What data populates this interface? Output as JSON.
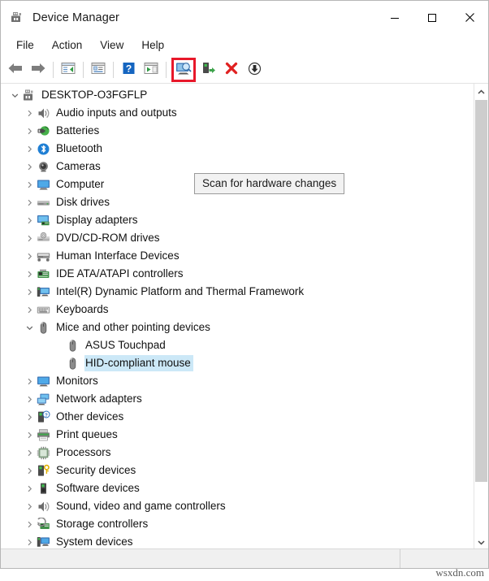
{
  "window": {
    "title": "Device Manager",
    "title_icon": "device-manager-icon",
    "controls": {
      "minimize": "minimize-icon",
      "maximize": "maximize-icon",
      "close": "close-icon"
    }
  },
  "menubar": {
    "items": [
      {
        "label": "File"
      },
      {
        "label": "Action"
      },
      {
        "label": "View"
      },
      {
        "label": "Help"
      }
    ]
  },
  "toolbar": {
    "highlight_color": "#e8182a",
    "buttons": [
      {
        "name": "back-button",
        "icon": "back-arrow-icon",
        "highlighted": false
      },
      {
        "name": "forward-button",
        "icon": "forward-arrow-icon",
        "highlighted": false
      },
      {
        "name": "show-hide-console-tree-button",
        "icon": "console-tree-icon",
        "highlighted": false
      },
      {
        "name": "properties-button",
        "icon": "properties-icon",
        "highlighted": false
      },
      {
        "name": "help-button",
        "icon": "help-question-icon",
        "highlighted": false
      },
      {
        "name": "show-hide-action-pane-button",
        "icon": "action-pane-icon",
        "highlighted": false
      },
      {
        "name": "scan-for-hardware-changes-button",
        "icon": "scan-hardware-icon",
        "highlighted": true
      },
      {
        "name": "update-driver-button",
        "icon": "update-driver-icon",
        "highlighted": false
      },
      {
        "name": "uninstall-device-button",
        "icon": "red-x-icon",
        "highlighted": false
      },
      {
        "name": "disable-device-button",
        "icon": "down-arrow-circle-icon",
        "highlighted": false
      }
    ]
  },
  "tooltip": {
    "text": "Scan for hardware changes"
  },
  "tree": {
    "items": [
      {
        "label": "DESKTOP-O3FGFLP",
        "level": 0,
        "twisty": "expanded",
        "icon": "computer-root-icon",
        "selected": false
      },
      {
        "label": "Audio inputs and outputs",
        "level": 1,
        "twisty": "collapsed",
        "icon": "speaker-icon",
        "selected": false
      },
      {
        "label": "Batteries",
        "level": 1,
        "twisty": "collapsed",
        "icon": "battery-icon",
        "selected": false
      },
      {
        "label": "Bluetooth",
        "level": 1,
        "twisty": "collapsed",
        "icon": "bluetooth-icon",
        "selected": false
      },
      {
        "label": "Cameras",
        "level": 1,
        "twisty": "collapsed",
        "icon": "camera-icon",
        "selected": false
      },
      {
        "label": "Computer",
        "level": 1,
        "twisty": "collapsed",
        "icon": "monitor-icon",
        "selected": false
      },
      {
        "label": "Disk drives",
        "level": 1,
        "twisty": "collapsed",
        "icon": "disk-drive-icon",
        "selected": false
      },
      {
        "label": "Display adapters",
        "level": 1,
        "twisty": "collapsed",
        "icon": "display-adapter-icon",
        "selected": false
      },
      {
        "label": "DVD/CD-ROM drives",
        "level": 1,
        "twisty": "collapsed",
        "icon": "dvd-drive-icon",
        "selected": false
      },
      {
        "label": "Human Interface Devices",
        "level": 1,
        "twisty": "collapsed",
        "icon": "hid-icon",
        "selected": false
      },
      {
        "label": "IDE ATA/ATAPI controllers",
        "level": 1,
        "twisty": "collapsed",
        "icon": "ide-controller-icon",
        "selected": false
      },
      {
        "label": "Intel(R) Dynamic Platform and Thermal Framework",
        "level": 1,
        "twisty": "collapsed",
        "icon": "thermal-framework-icon",
        "selected": false
      },
      {
        "label": "Keyboards",
        "level": 1,
        "twisty": "collapsed",
        "icon": "keyboard-icon",
        "selected": false
      },
      {
        "label": "Mice and other pointing devices",
        "level": 1,
        "twisty": "expanded",
        "icon": "mouse-icon",
        "selected": false
      },
      {
        "label": "ASUS Touchpad",
        "level": 2,
        "twisty": "none",
        "icon": "mouse-icon",
        "selected": false
      },
      {
        "label": "HID-compliant mouse",
        "level": 2,
        "twisty": "none",
        "icon": "mouse-icon",
        "selected": true
      },
      {
        "label": "Monitors",
        "level": 1,
        "twisty": "collapsed",
        "icon": "monitor-icon",
        "selected": false
      },
      {
        "label": "Network adapters",
        "level": 1,
        "twisty": "collapsed",
        "icon": "network-adapter-icon",
        "selected": false
      },
      {
        "label": "Other devices",
        "level": 1,
        "twisty": "collapsed",
        "icon": "other-device-icon",
        "selected": false
      },
      {
        "label": "Print queues",
        "level": 1,
        "twisty": "collapsed",
        "icon": "printer-icon",
        "selected": false
      },
      {
        "label": "Processors",
        "level": 1,
        "twisty": "collapsed",
        "icon": "processor-icon",
        "selected": false
      },
      {
        "label": "Security devices",
        "level": 1,
        "twisty": "collapsed",
        "icon": "security-device-icon",
        "selected": false
      },
      {
        "label": "Software devices",
        "level": 1,
        "twisty": "collapsed",
        "icon": "software-device-icon",
        "selected": false
      },
      {
        "label": "Sound, video and game controllers",
        "level": 1,
        "twisty": "collapsed",
        "icon": "speaker-icon",
        "selected": false
      },
      {
        "label": "Storage controllers",
        "level": 1,
        "twisty": "collapsed",
        "icon": "storage-controller-icon",
        "selected": false
      },
      {
        "label": "System devices",
        "level": 1,
        "twisty": "collapsed",
        "icon": "system-device-icon",
        "selected": false
      }
    ]
  },
  "scrollbar": {
    "up_arrow": "chevron-up-icon",
    "down_arrow": "chevron-down-icon"
  },
  "statusbar": {
    "text": ""
  },
  "watermark": {
    "text": "wsxdn.com"
  }
}
